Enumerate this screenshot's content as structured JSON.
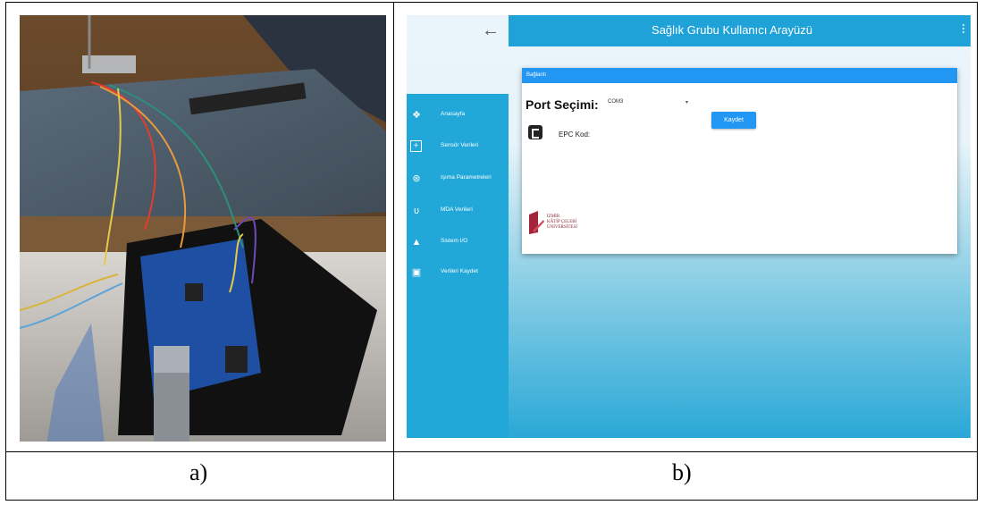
{
  "captions": {
    "a": "a)",
    "b": "b)"
  },
  "app": {
    "title": "Sağlık Grubu Kullanıcı Arayüzü",
    "back_icon": "arrow-left-icon",
    "sidebar": {
      "items": [
        {
          "label": "Anasayfa",
          "icon": "home-icon"
        },
        {
          "label": "Sensör Verileri",
          "icon": "plus-box-icon"
        },
        {
          "label": "Işıma Parametreleri",
          "icon": "antenna-icon"
        },
        {
          "label": "MDA Verileri",
          "icon": "stethoscope-icon"
        },
        {
          "label": "Sistem I/O",
          "icon": "pin-icon"
        },
        {
          "label": "Verileri Kaydet",
          "icon": "floppy-icon"
        }
      ]
    },
    "card": {
      "header": "Bağlantı",
      "port_label": "Port Seçimi:",
      "port_value": "COM3",
      "save_button": "Kaydet",
      "epc_label": "EPC Kod:",
      "logo_lines": [
        "İZMİR",
        "KÂTİP ÇELEBİ",
        "ÜNİVERSİTESİ"
      ]
    }
  }
}
